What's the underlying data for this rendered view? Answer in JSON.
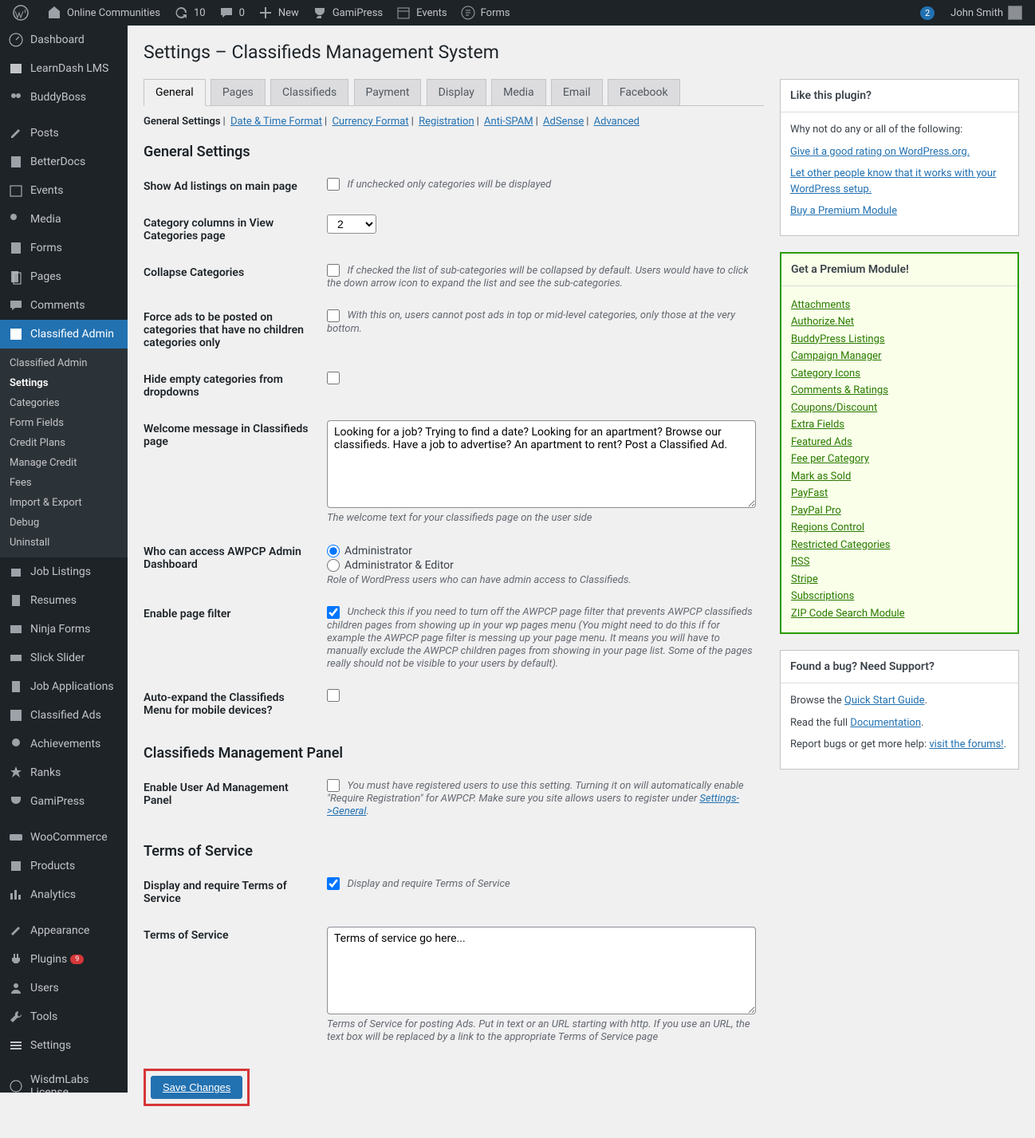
{
  "adminbar": {
    "site": "Online Communities",
    "updates": "10",
    "comments": "0",
    "new": "New",
    "gamipress": "GamiPress",
    "events": "Events",
    "forms": "Forms",
    "notif": "2",
    "user": "John Smith"
  },
  "sidebar": {
    "items": [
      {
        "label": "Dashboard"
      },
      {
        "label": "LearnDash LMS"
      },
      {
        "label": "BuddyBoss"
      },
      {
        "label": "Posts"
      },
      {
        "label": "BetterDocs"
      },
      {
        "label": "Events"
      },
      {
        "label": "Media"
      },
      {
        "label": "Forms"
      },
      {
        "label": "Pages"
      },
      {
        "label": "Comments"
      },
      {
        "label": "Classified Admin"
      },
      {
        "label": "Job Listings"
      },
      {
        "label": "Resumes"
      },
      {
        "label": "Ninja Forms"
      },
      {
        "label": "Slick Slider"
      },
      {
        "label": "Job Applications"
      },
      {
        "label": "Classified Ads"
      },
      {
        "label": "Achievements"
      },
      {
        "label": "Ranks"
      },
      {
        "label": "GamiPress"
      },
      {
        "label": "WooCommerce"
      },
      {
        "label": "Products"
      },
      {
        "label": "Analytics"
      },
      {
        "label": "Appearance"
      },
      {
        "label": "Plugins"
      },
      {
        "label": "Users"
      },
      {
        "label": "Tools"
      },
      {
        "label": "Settings"
      },
      {
        "label": "WisdmLabs License"
      }
    ],
    "plugins_badge": "9",
    "submenu": [
      "Classified Admin",
      "Settings",
      "Categories",
      "Form Fields",
      "Credit Plans",
      "Manage Credit",
      "Fees",
      "Import & Export",
      "Debug",
      "Uninstall"
    ]
  },
  "page": {
    "title": "Settings – Classifieds Management System"
  },
  "tabs": [
    "General",
    "Pages",
    "Classifieds",
    "Payment",
    "Display",
    "Media",
    "Email",
    "Facebook"
  ],
  "subtabs": {
    "active": "General Settings",
    "links": [
      "Date & Time Format",
      "Currency Format",
      "Registration",
      "Anti-SPAM",
      "AdSense",
      "Advanced"
    ]
  },
  "sections": {
    "general": "General Settings",
    "panel": "Classifieds Management Panel",
    "tos": "Terms of Service"
  },
  "fields": {
    "show_main": {
      "label": "Show Ad listings on main page",
      "desc": "If unchecked only categories will be displayed"
    },
    "cat_cols": {
      "label": "Category columns in View Categories page",
      "value": "2"
    },
    "collapse": {
      "label": "Collapse Categories",
      "desc": "If checked the list of sub-categories will be collapsed by default. Users would have to click the down arrow icon to expand the list and see the sub-categories."
    },
    "force": {
      "label": "Force ads to be posted on categories that have no children categories only",
      "desc": "With this on, users cannot post ads in top or mid-level categories, only those at the very bottom."
    },
    "hide_empty": {
      "label": "Hide empty categories from dropdowns"
    },
    "welcome": {
      "label": "Welcome message in Classifieds page",
      "value": "Looking for a job? Trying to find a date? Looking for an apartment? Browse our classifieds. Have a job to advertise? An apartment to rent? Post a Classified Ad.",
      "desc": "The welcome text for your classifieds page on the user side"
    },
    "access": {
      "label": "Who can access AWPCP Admin Dashboard",
      "opt1": "Administrator",
      "opt2": "Administrator & Editor",
      "desc": "Role of WordPress users who can have admin access to Classifieds."
    },
    "pagefilter": {
      "label": "Enable page filter",
      "desc": "Uncheck this if you need to turn off the AWPCP page filter that prevents AWPCP classifieds children pages from showing up in your wp pages menu (You might need to do this if for example the AWPCP page filter is messing up your page menu. It means you will have to manually exclude the AWPCP children pages from showing in your page list. Some of the pages really should not be visible to your users by default)."
    },
    "autoexpand": {
      "label": "Auto-expand the Classifieds Menu for mobile devices?"
    },
    "userpanel": {
      "label": "Enable User Ad Management Panel",
      "desc1": "You must have registered users to use this setting. Turning it on will automatically enable \"Require Registration\" for AWPCP. Make sure you site allows users to register under ",
      "link": "Settings->General",
      "desc2": "."
    },
    "tos_req": {
      "label": "Display and require Terms of Service",
      "desc": "Display and require Terms of Service"
    },
    "tos_text": {
      "label": "Terms of Service",
      "value": "Terms of service go here...",
      "desc": "Terms of Service for posting Ads. Put in text or an URL starting with http. If you use an URL, the text box will be replaced by a link to the appropriate Terms of Service page"
    }
  },
  "save": "Save Changes",
  "side": {
    "like": {
      "title": "Like this plugin?",
      "intro": "Why not do any or all of the following:",
      "links": [
        "Give it a good rating on WordPress.org.",
        "Let other people know that it works with your WordPress setup.",
        "Buy a Premium Module"
      ]
    },
    "premium": {
      "title": "Get a Premium Module!",
      "links": [
        "Attachments",
        "Authorize.Net",
        "BuddyPress Listings",
        "Campaign Manager",
        "Category Icons",
        "Comments & Ratings",
        "Coupons/Discount",
        "Extra Fields",
        "Featured Ads",
        "Fee per Category",
        "Mark as Sold",
        "PayFast",
        "PayPal Pro",
        "Regions Control",
        "Restricted Categories",
        "RSS",
        "Stripe",
        "Subscriptions",
        "ZIP Code Search Module"
      ]
    },
    "bug": {
      "title": "Found a bug? Need Support?",
      "l1a": "Browse the ",
      "l1b": "Quick Start Guide",
      "l2a": "Read the full ",
      "l2b": "Documentation",
      "l3a": "Report bugs or get more help: ",
      "l3b": "visit the forums!"
    }
  }
}
